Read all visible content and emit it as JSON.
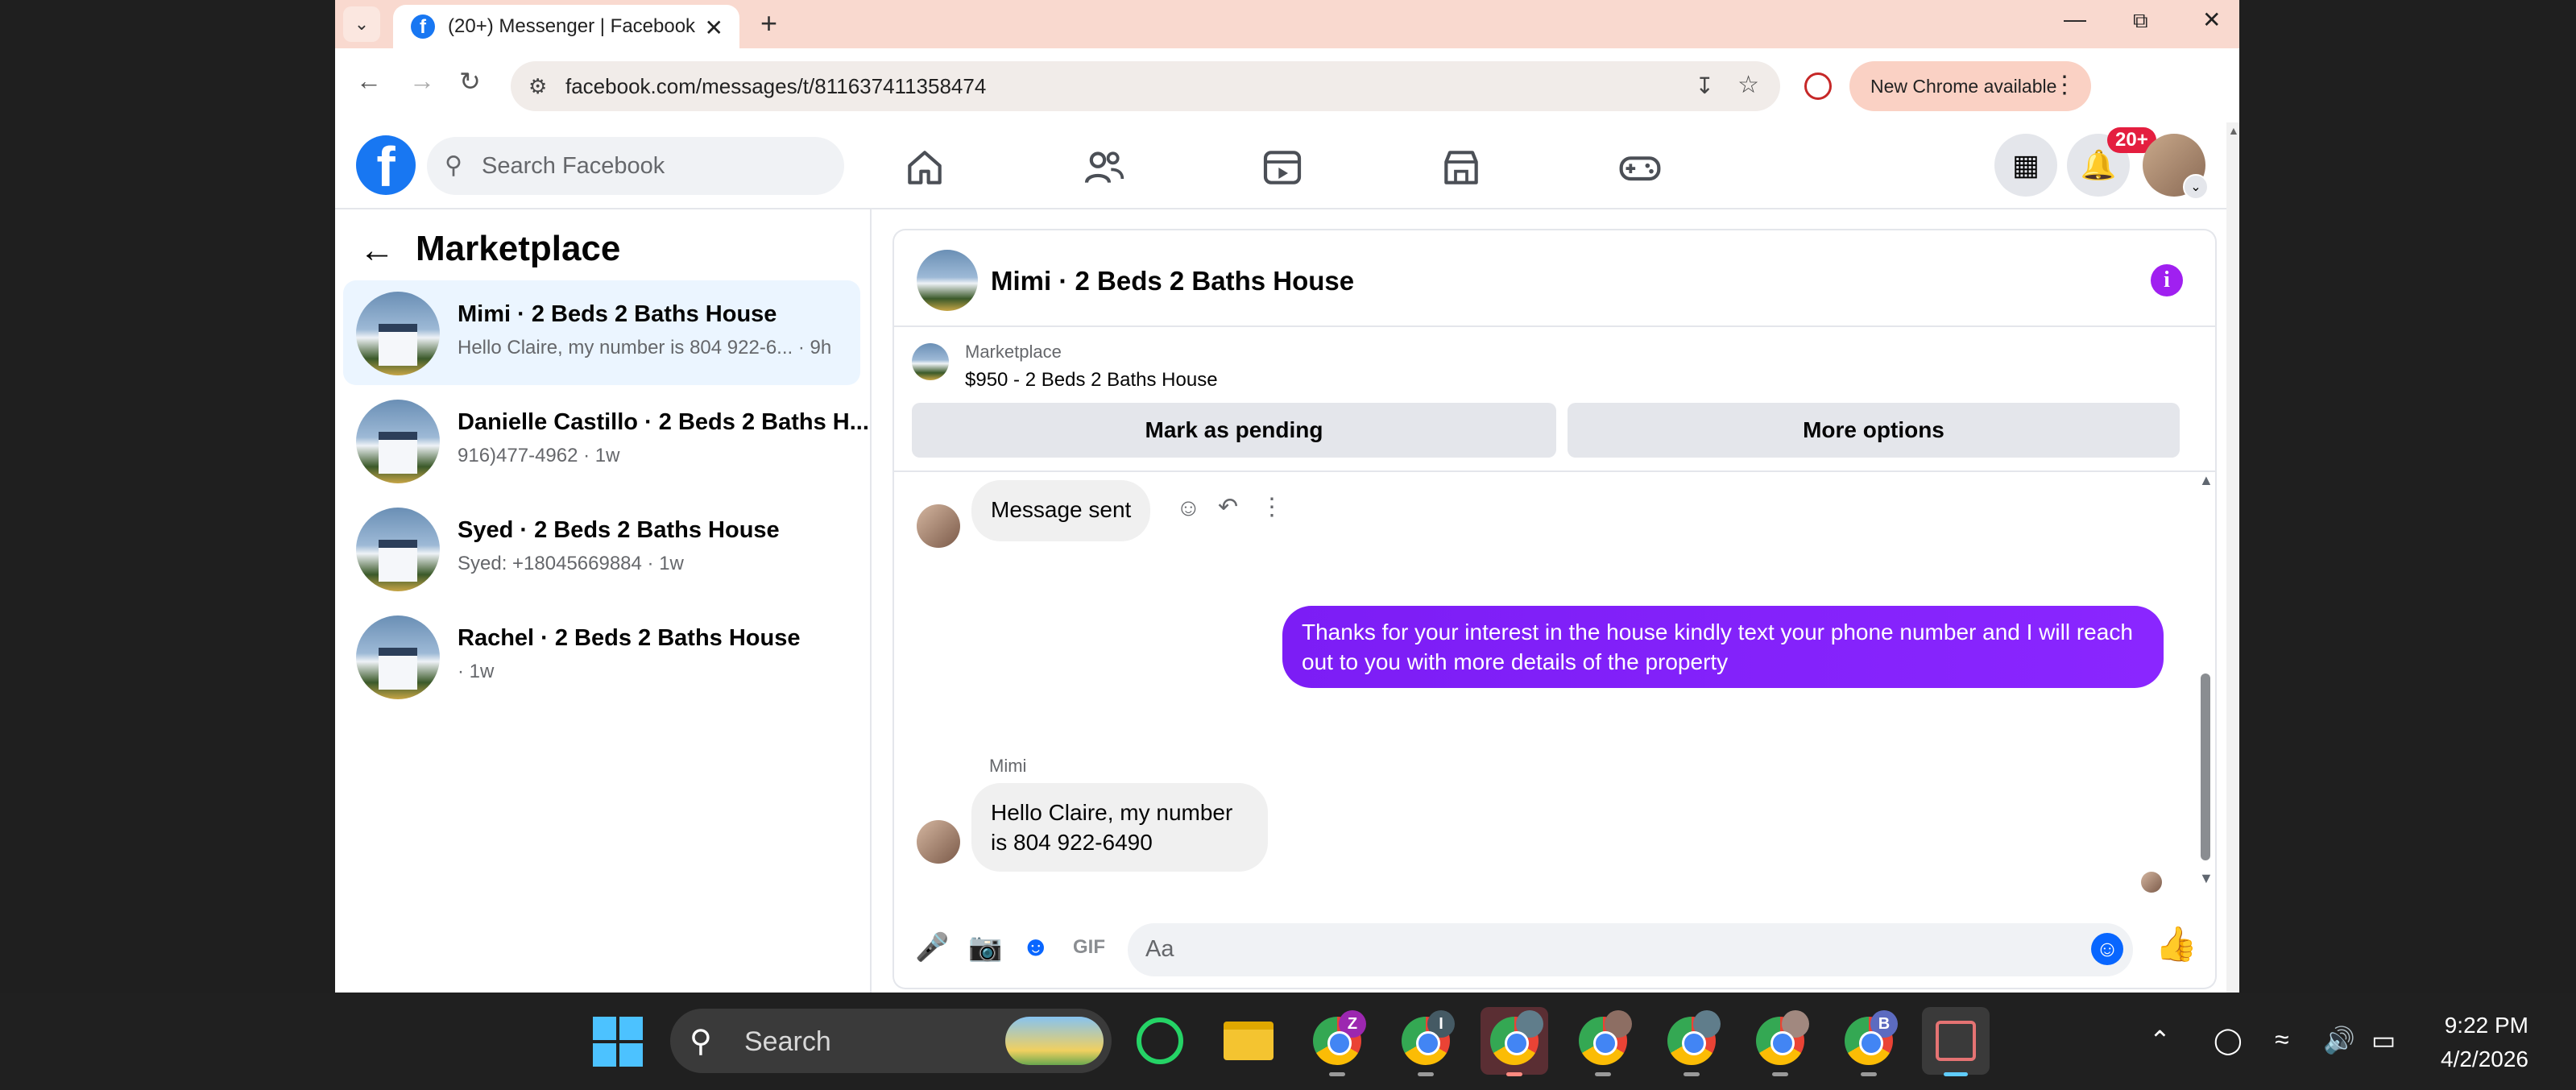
{
  "browser": {
    "tab_title": "(20+) Messenger | Facebook",
    "url": "facebook.com/messages/t/811637411358474",
    "new_chrome_label": "New Chrome available"
  },
  "facebook": {
    "search_placeholder": "Search Facebook",
    "notification_badge": "20+"
  },
  "sidebar": {
    "title": "Marketplace",
    "conversations": [
      {
        "name": "Mimi · 2 Beds 2 Baths House",
        "snippet": "Hello Claire, my number is 804 922-6... · 9h",
        "selected": true
      },
      {
        "name": "Danielle Castillo · 2 Beds 2 Baths H...",
        "snippet": "916)477-4962 · 1w",
        "selected": false
      },
      {
        "name": "Syed · 2 Beds 2 Baths House",
        "snippet": "Syed: +18045669884 · 1w",
        "selected": false
      },
      {
        "name": "Rachel · 2 Beds 2 Baths House",
        "snippet": " · 1w",
        "selected": false
      }
    ]
  },
  "chat": {
    "header_title": "Mimi · 2 Beds 2 Baths House",
    "marketplace_label": "Marketplace",
    "listing": "$950 - 2 Beds 2 Baths House",
    "mark_pending": "Mark as pending",
    "more_options": "More options",
    "messages": [
      {
        "from": "them",
        "text": "Message sent"
      },
      {
        "from": "me",
        "text": "Thanks for your interest in the house kindly text your phone number and I will reach out to you with more details of the property"
      },
      {
        "from": "them",
        "sender": "Mimi",
        "text": "Hello Claire, my number is 804 922-6490"
      }
    ],
    "composer_placeholder": "Aa"
  },
  "taskbar": {
    "search_label": "Search",
    "time": "9:22 PM",
    "date": "4/2/2026",
    "chrome_badges": [
      "Z",
      "I",
      "",
      "",
      "",
      "",
      "B"
    ]
  },
  "colors": {
    "facebook_blue": "#1877f2",
    "messenger_purple": "#7b19f5",
    "selected_bg": "#ebf5ff",
    "tab_strip": "#f9d9cf"
  }
}
